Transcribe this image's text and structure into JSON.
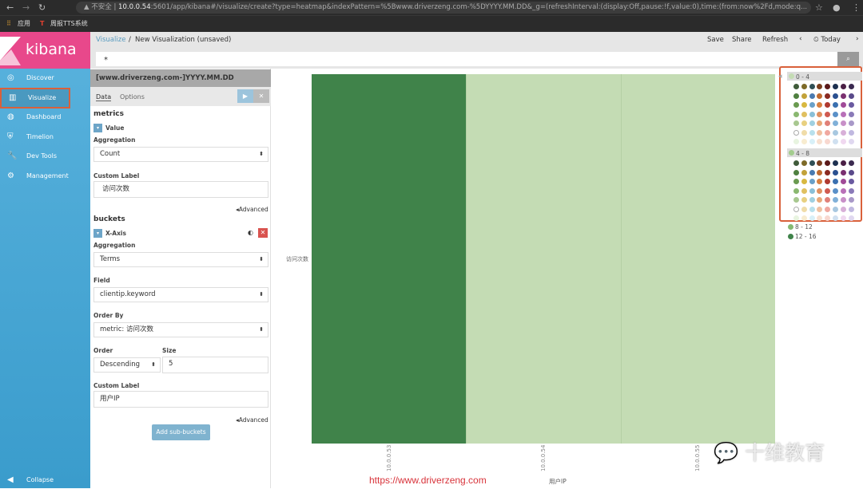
{
  "browser": {
    "url_host": "10.0.0.54",
    "url_rest": ":5601/app/kibana#/visualize/create?type=heatmap&indexPattern=%5Bwww.driverzeng.com-%5DYYYY.MM.DD&_g=(refreshInterval:(display:Off,pause:!f,value:0),time:(from:now%2Fd,mode:q...",
    "security": "不安全",
    "bookmarks": [
      "应用",
      "周报TTS系统"
    ]
  },
  "app": {
    "logo": "kibana"
  },
  "sidebar": {
    "items": [
      {
        "label": "Discover",
        "icon": "compass-icon"
      },
      {
        "label": "Visualize",
        "icon": "bar-chart-icon",
        "active": true
      },
      {
        "label": "Dashboard",
        "icon": "dashboard-icon"
      },
      {
        "label": "Timelion",
        "icon": "timelion-icon"
      },
      {
        "label": "Dev Tools",
        "icon": "wrench-icon"
      },
      {
        "label": "Management",
        "icon": "gear-icon"
      }
    ],
    "collapse": "Collapse"
  },
  "topbar": {
    "breadcrumb_link": "Visualize",
    "breadcrumb_sep": "/",
    "title": "New Visualization (unsaved)",
    "save": "Save",
    "share": "Share",
    "refresh": "Refresh",
    "time": "Today"
  },
  "query": {
    "value": "*"
  },
  "editor": {
    "index": "[www.driverzeng.com-]YYYY.MM.DD",
    "tabs": [
      "Data",
      "Options"
    ],
    "metrics_title": "metrics",
    "metric_name": "Value",
    "aggregation_label": "Aggregation",
    "aggregation": "Count",
    "custom_label_label": "Custom Label",
    "custom_label": "访问次数",
    "advanced": "Advanced",
    "buckets_title": "buckets",
    "bucket_name": "X-Axis",
    "bucket_aggregation": "Terms",
    "field_label": "Field",
    "field": "clientip.keyword",
    "order_by_label": "Order By",
    "order_by": "metric: 访问次数",
    "order_label": "Order",
    "order": "Descending",
    "size_label": "Size",
    "size": "5",
    "bucket_custom_label": "用户IP",
    "add_sub": "Add sub-buckets"
  },
  "chart_data": {
    "type": "heatmap",
    "xlabel": "用户IP",
    "ylabel": "访问次数",
    "categories": [
      "10.0.0.53",
      "10.0.0.54",
      "10.0.0.55"
    ],
    "values": [
      14,
      2,
      2
    ],
    "legend": [
      "0 - 4",
      "4 - 8",
      "8 - 12",
      "12 - 16"
    ],
    "legend_colors": [
      "#c4dcb4",
      "#a3cc8e",
      "#85b972",
      "#40834a"
    ],
    "legend_placement": "right"
  },
  "palette": [
    [
      "#3f5b3a",
      "#7d6a28",
      "#2f4f55",
      "#7a3f1f",
      "#5b1a1a",
      "#1d3050",
      "#4a1f45",
      "#3b2a50"
    ],
    [
      "#4f8040",
      "#c2a23a",
      "#4a7ab0",
      "#c06a30",
      "#8a2a22",
      "#2a5090",
      "#7a3070",
      "#5a4a8a"
    ],
    [
      "#6a9a50",
      "#d8b840",
      "#6aa0c8",
      "#d88040",
      "#b03a30",
      "#3a70b0",
      "#a04a98",
      "#6a5aa0"
    ],
    [
      "#8ab870",
      "#e0c060",
      "#8ac0d8",
      "#e09060",
      "#d05a50",
      "#5a90c8",
      "#b870b8",
      "#8a7ab8"
    ],
    [
      "#a8c890",
      "#e8d080",
      "#a0d0e0",
      "#e8a878",
      "#e08078",
      "#80b0d8",
      "#c890c8",
      "#a898c8"
    ],
    [
      "#ffffff",
      "#f0dca8",
      "#b8e0ec",
      "#f0c0a0",
      "#f0a8a0",
      "#a8c8e0",
      "#d8b0d8",
      "#c0b8e0"
    ],
    [
      "#e8f4e0",
      "#f8ecd0",
      "#d8f0f8",
      "#f8e0d0",
      "#f8d8d0",
      "#d0e0f0",
      "#f0d8f0",
      "#e0d8f0"
    ]
  ],
  "watermark": {
    "url": "https://www.driverzeng.com",
    "brand": "十维教育"
  }
}
